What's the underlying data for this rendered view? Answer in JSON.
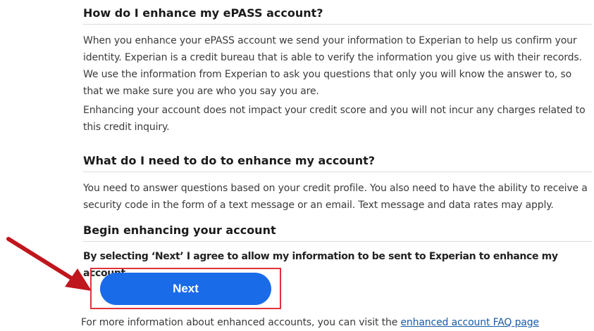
{
  "sections": [
    {
      "heading": "How do I enhance my ePASS account?",
      "paragraphs": [
        "When you enhance your ePASS account we send your information to Experian to help us confirm your identity. Experian is a credit bureau that is able to verify the information you give us with their records. We use the information from Experian to ask you questions that only you will know the answer to, so that we make sure you are who you say you are.",
        "Enhancing your account does not impact your credit score and you will not incur any charges related to this credit inquiry."
      ]
    },
    {
      "heading": "What do I need to do to enhance my account?",
      "paragraphs": [
        "You need to answer questions based on your credit profile. You also need to have the ability to receive a security code in the form of a text message or an email. Text message and data rates may apply."
      ]
    },
    {
      "heading": "Begin enhancing your account",
      "consent": "By selecting ‘Next’ I agree to allow my information to be sent to Experian to enhance my account."
    }
  ],
  "next_button": {
    "label": "Next"
  },
  "footer": {
    "text": "For more information about enhanced accounts, you can visit the ",
    "link_label": "enhanced account FAQ page"
  },
  "colors": {
    "button": "#1a6be8",
    "highlight": "#e0313a",
    "arrow": "#c0161d",
    "link": "#1a5aa6"
  },
  "annotation": {
    "arrow_icon": "red-pointer-arrow-icon"
  }
}
